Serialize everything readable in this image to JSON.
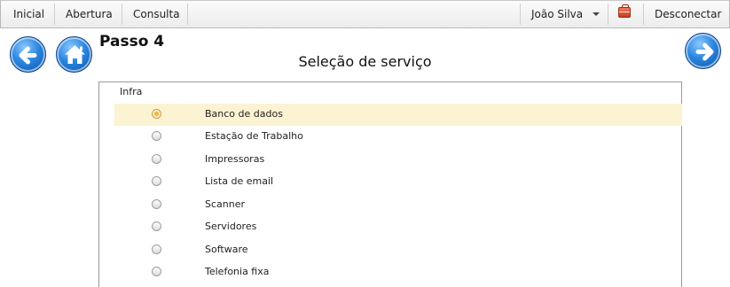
{
  "topbar": {
    "items": [
      {
        "label": "Inicial"
      },
      {
        "label": "Abertura"
      },
      {
        "label": "Consulta"
      }
    ],
    "user_name": "João Silva",
    "logout_label": "Desconectar"
  },
  "page": {
    "step_title": "Passo 4",
    "subtitle": "Seleção de serviço"
  },
  "services": {
    "group_label": "Infra",
    "selected": "Banco de dados",
    "options": [
      {
        "label": "Banco de dados",
        "checked": true
      },
      {
        "label": "Estação de Trabalho",
        "checked": false
      },
      {
        "label": "Impressoras",
        "checked": false
      },
      {
        "label": "Lista de email",
        "checked": false
      },
      {
        "label": "Scanner",
        "checked": false
      },
      {
        "label": "Servidores",
        "checked": false
      },
      {
        "label": "Software",
        "checked": false
      },
      {
        "label": "Telefonia fixa",
        "checked": false
      }
    ]
  },
  "icons": {
    "back": "arrow-left-icon",
    "home": "home-icon",
    "next": "arrow-right-icon",
    "toolbox": "toolbox-icon",
    "user_menu": "caret-down-icon"
  },
  "colors": {
    "accent_blue": "#1f6fc9",
    "selected_row": "#fcf3d2"
  }
}
